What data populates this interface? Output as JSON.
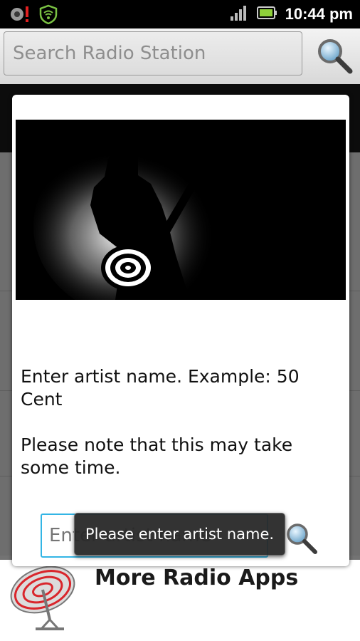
{
  "status_bar": {
    "time": "10:44 pm",
    "icons": [
      "notification-alert-icon",
      "wifi-shield-icon",
      "signal-icon",
      "battery-icon"
    ]
  },
  "search": {
    "placeholder": "Search Radio Station",
    "icon": "search-icon"
  },
  "dialog": {
    "message": "Enter artist name. Example: 50 Cent\n\n Please note that this may take some time.",
    "input_placeholder": "Enter artist name",
    "search_icon": "search-icon",
    "hero_image": "guitarist-silhouette"
  },
  "toast": {
    "text": "Please enter artist name."
  },
  "list": {
    "more_apps_label": "More Radio Apps",
    "more_apps_icon": "satellite-dish-icon"
  },
  "colors": {
    "focus_accent": "#33b5e5",
    "dish_red": "#d9262c"
  }
}
